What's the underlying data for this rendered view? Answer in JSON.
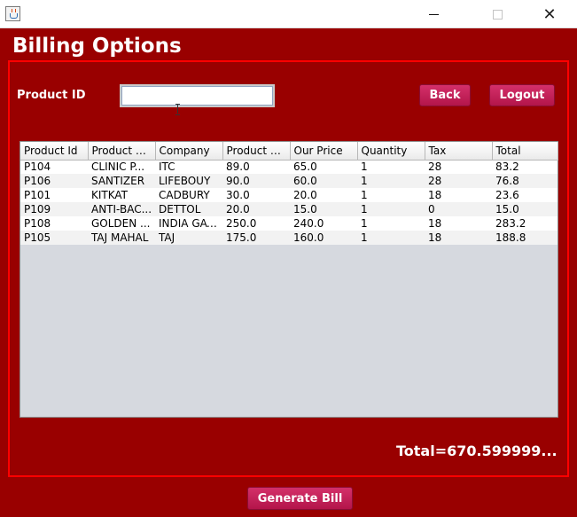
{
  "window": {
    "icon": "java-icon",
    "minimize_icon": "minimize-icon",
    "maximize_icon": "maximize-icon",
    "close_glyph": "✕"
  },
  "heading": "Billing Options",
  "form": {
    "product_id_label": "Product ID",
    "product_id_value": "",
    "product_id_placeholder": ""
  },
  "buttons": {
    "back": "Back",
    "logout": "Logout",
    "generate_bill": "Generate Bill"
  },
  "table": {
    "columns": [
      "Product Id",
      "Product N...",
      "Company",
      "Product Pr...",
      "Our Price",
      "Quantity",
      "Tax",
      "Total"
    ],
    "rows": [
      [
        "P104",
        "CLINIC P...",
        "ITC",
        "89.0",
        "65.0",
        "1",
        "28",
        "83.2"
      ],
      [
        "P106",
        "SANTIZER",
        "LIFEBOUY",
        "90.0",
        "60.0",
        "1",
        "28",
        "76.8"
      ],
      [
        "P101",
        "KITKAT",
        "CADBURY",
        "30.0",
        "20.0",
        "1",
        "18",
        "23.6"
      ],
      [
        "P109",
        "ANTI-BAC...",
        "DETTOL",
        "20.0",
        "15.0",
        "1",
        "0",
        "15.0"
      ],
      [
        "P108",
        "GOLDEN ...",
        "INDIA GATE",
        "250.0",
        "240.0",
        "1",
        "18",
        "283.2"
      ],
      [
        "P105",
        "TAJ MAHAL",
        "TAJ",
        "175.0",
        "160.0",
        "1",
        "18",
        "188.8"
      ]
    ]
  },
  "total_text": "Total=670.599999...",
  "colors": {
    "background": "#990000",
    "panel_border": "#ff0000",
    "button": "#c71f58",
    "table_empty": "#d6d9df"
  }
}
